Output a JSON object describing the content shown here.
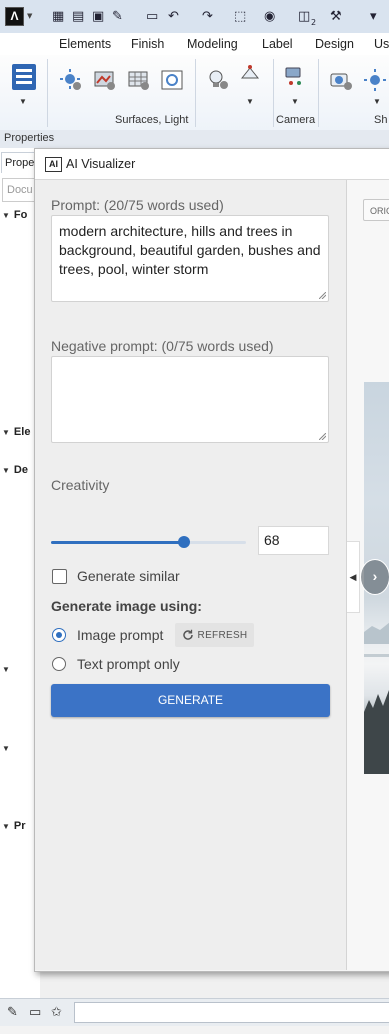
{
  "window": {
    "logo_glyph": "Λ",
    "quick_access": [
      {
        "name": "catalog-icon",
        "glyph": "▦"
      },
      {
        "name": "grid-icon",
        "glyph": "▤"
      },
      {
        "name": "save-icon",
        "glyph": "▣"
      },
      {
        "name": "edit-icon",
        "glyph": "✎"
      },
      {
        "name": "pick-icon",
        "glyph": "▭"
      },
      {
        "name": "undo-icon",
        "glyph": "↶"
      },
      {
        "name": "redo-icon",
        "glyph": "↷"
      },
      {
        "name": "selection-icon",
        "glyph": "⬚"
      },
      {
        "name": "view-icon",
        "glyph": "◉"
      },
      {
        "name": "floor-icon",
        "glyph": "◫"
      },
      {
        "name": "tools-icon",
        "glyph": "⚒"
      },
      {
        "name": "more-icon",
        "glyph": "▾"
      }
    ],
    "floor_badge": "2"
  },
  "ribbon": {
    "tabs": [
      "Elements",
      "Finish",
      "Modeling",
      "Label",
      "Design",
      "Us"
    ],
    "groups": {
      "surfaces": "Surfaces, Light",
      "camera": "Camera",
      "sh": "Sh"
    }
  },
  "properties": {
    "header": "Properties",
    "tab_label": "Prope",
    "search_placeholder": "Docu",
    "rows": [
      "Fo",
      "Ele",
      "De",
      "",
      "",
      "Pr"
    ]
  },
  "dialog": {
    "ai_badge": "AI",
    "title": "AI Visualizer",
    "prompt_label": "Prompt: (20/75 words used)",
    "prompt_text": "modern architecture, hills and trees in background, beautiful garden, bushes and trees, pool, winter storm",
    "negative_label": "Negative prompt: (0/75 words used)",
    "negative_text": "",
    "creativity_label": "Creativity",
    "creativity_value": "68",
    "creativity_fraction": 0.68,
    "generate_similar_label": "Generate similar",
    "generate_similar_checked": false,
    "generate_using_label": "Generate image using:",
    "option_image": "Image prompt",
    "option_text": "Text prompt only",
    "selected_option": "image",
    "refresh_label": "REFRESH",
    "generate_label": "GENERATE",
    "original_tab": "ORIG",
    "accent_color": "#3b73c6"
  }
}
